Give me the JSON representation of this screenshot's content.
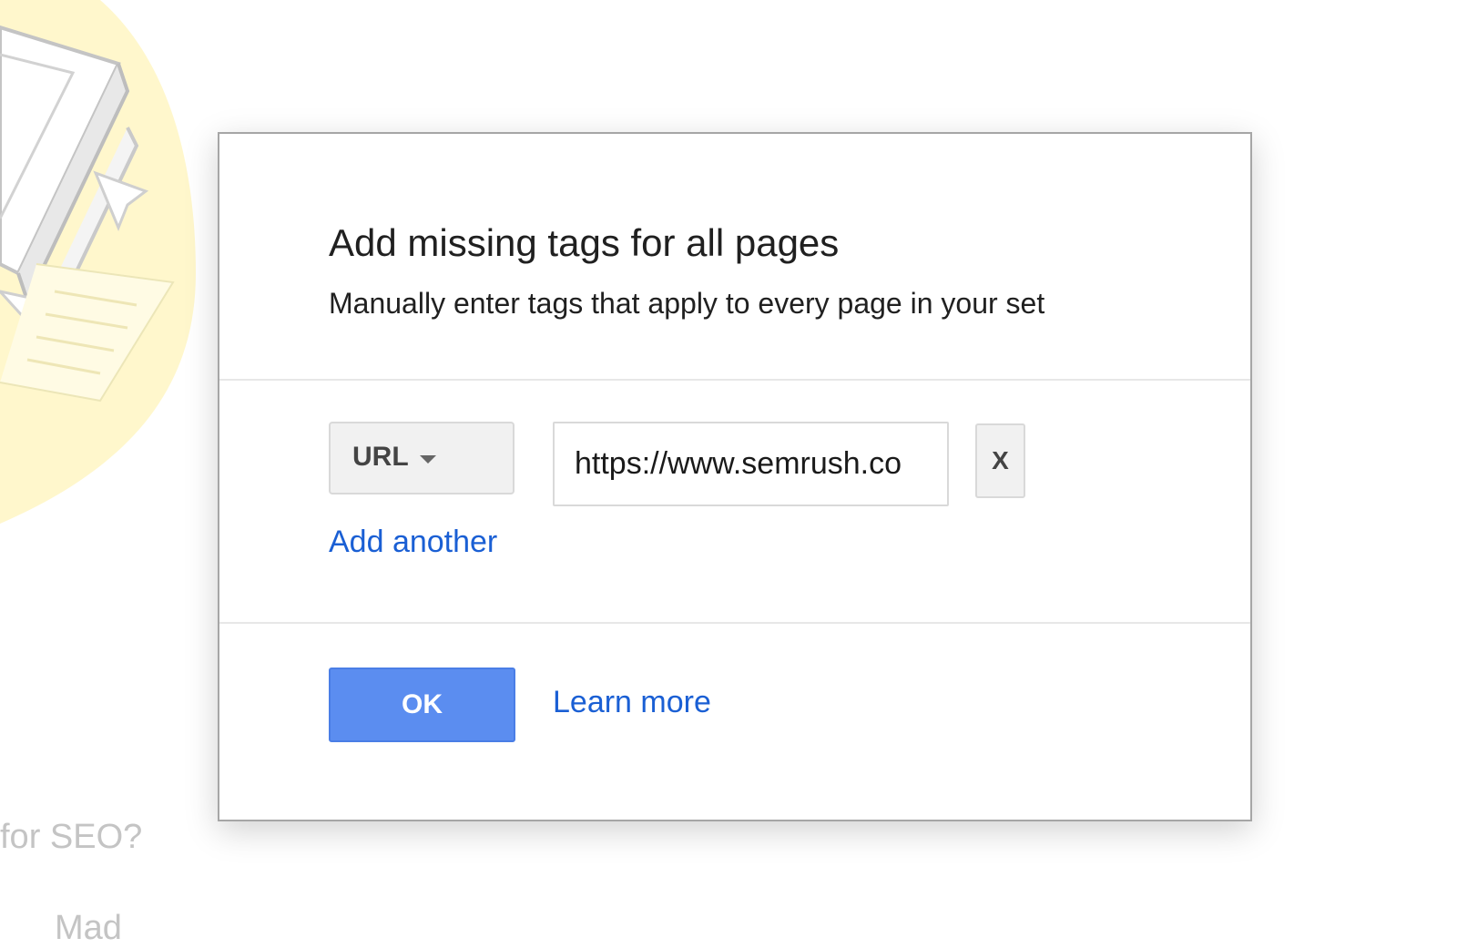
{
  "background": {
    "illustration_icon": "book-with-bookmarks-illustration",
    "partial_text_1": "for SEO?",
    "partial_text_2": "Mad"
  },
  "dialog": {
    "title": "Add missing tags for all pages",
    "subtitle": "Manually enter tags that apply to every page in your set",
    "tag_row": {
      "type_selected": "URL",
      "value": "https://www.semrush.co",
      "remove_label": "X"
    },
    "add_another_label": "Add another",
    "ok_label": "OK",
    "learn_more_label": "Learn more"
  },
  "colors": {
    "accent_button": "#5b8df0",
    "link": "#1a5fd4",
    "illustration_yellow": "#fff6c9"
  }
}
